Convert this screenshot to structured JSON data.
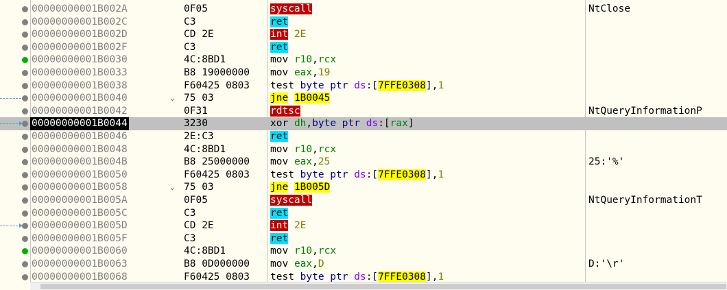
{
  "rows": [
    {
      "addr": "00000000001B002A",
      "bytes": "0F05",
      "mn": "syscall",
      "mn_style": "red",
      "ops": [],
      "comment": "NtClose",
      "bp": "gray"
    },
    {
      "addr": "00000000001B002C",
      "bytes": "C3",
      "mn": "ret",
      "mn_style": "cyan",
      "ops": [],
      "comment": "",
      "bp": "gray"
    },
    {
      "addr": "00000000001B002D",
      "bytes": "CD 2E",
      "mn": "int",
      "mn_style": "red",
      "ops": [
        {
          "t": " "
        },
        {
          "t": "2E",
          "c": "num"
        }
      ],
      "comment": "",
      "bp": "gray"
    },
    {
      "addr": "00000000001B002F",
      "bytes": "C3",
      "mn": "ret",
      "mn_style": "cyan",
      "ops": [],
      "comment": "",
      "bp": "gray"
    },
    {
      "addr": "00000000001B0030",
      "bytes": "4C:8BD1",
      "mn": "mov",
      "mn_style": "plain",
      "ops": [
        {
          "t": " "
        },
        {
          "t": "r10",
          "c": "reg"
        },
        {
          "t": ","
        },
        {
          "t": "rcx",
          "c": "reg"
        }
      ],
      "comment": "",
      "bp": "green"
    },
    {
      "addr": "00000000001B0033",
      "bytes": "B8 19000000",
      "mn": "mov",
      "mn_style": "plain",
      "ops": [
        {
          "t": " "
        },
        {
          "t": "eax",
          "c": "reg"
        },
        {
          "t": ","
        },
        {
          "t": "19",
          "c": "num"
        }
      ],
      "comment": "",
      "bp": "gray"
    },
    {
      "addr": "00000000001B0038",
      "bytes": "F60425 0803",
      "mn": "test",
      "mn_style": "plain",
      "ops": [
        {
          "t": " "
        },
        {
          "t": "byte ptr",
          "c": "kw"
        },
        {
          "t": " "
        },
        {
          "t": "ds",
          "c": "seg"
        },
        {
          "t": ":["
        },
        {
          "t": "7FFE0308",
          "c": "hl"
        },
        {
          "t": "],"
        },
        {
          "t": "1",
          "c": "num"
        }
      ],
      "comment": "",
      "bp": "gray"
    },
    {
      "addr": "00000000001B0040",
      "bytes": "75 03",
      "mn": "jne",
      "mn_style": "yellow",
      "ops": [
        {
          "t": " "
        },
        {
          "t": "1B0045",
          "c": "hl"
        }
      ],
      "comment": "",
      "bp": "gray",
      "mark": "⌄",
      "arrow": "in"
    },
    {
      "addr": "00000000001B0042",
      "bytes": "0F31",
      "mn": "rdtsc",
      "mn_style": "red",
      "ops": [],
      "comment": "NtQueryInformationP",
      "bp": "gray"
    },
    {
      "addr": "00000000001B0044",
      "bytes": "3230",
      "mn": "xor",
      "mn_style": "plain",
      "ops": [
        {
          "t": " "
        },
        {
          "t": "dh",
          "c": "reg"
        },
        {
          "t": ","
        },
        {
          "t": "byte ptr",
          "c": "kw"
        },
        {
          "t": " "
        },
        {
          "t": "ds",
          "c": "seg"
        },
        {
          "t": ":["
        },
        {
          "t": "rax",
          "c": "reg"
        },
        {
          "t": "]"
        }
      ],
      "comment": "",
      "bp": "gray",
      "selected": true,
      "arrow": "head"
    },
    {
      "addr": "00000000001B0046",
      "bytes": "2E:C3",
      "mn": "ret",
      "mn_style": "cyan",
      "ops": [],
      "comment": "",
      "bp": "gray"
    },
    {
      "addr": "00000000001B0048",
      "bytes": "4C:8BD1",
      "mn": "mov",
      "mn_style": "plain",
      "ops": [
        {
          "t": " "
        },
        {
          "t": "r10",
          "c": "reg"
        },
        {
          "t": ","
        },
        {
          "t": "rcx",
          "c": "reg"
        }
      ],
      "comment": "",
      "bp": "gray"
    },
    {
      "addr": "00000000001B004B",
      "bytes": "B8 25000000",
      "mn": "mov",
      "mn_style": "plain",
      "ops": [
        {
          "t": " "
        },
        {
          "t": "eax",
          "c": "reg"
        },
        {
          "t": ","
        },
        {
          "t": "25",
          "c": "num"
        }
      ],
      "comment": "25:'%'",
      "bp": "gray"
    },
    {
      "addr": "00000000001B0050",
      "bytes": "F60425 0803",
      "mn": "test",
      "mn_style": "plain",
      "ops": [
        {
          "t": " "
        },
        {
          "t": "byte ptr",
          "c": "kw"
        },
        {
          "t": " "
        },
        {
          "t": "ds",
          "c": "seg"
        },
        {
          "t": ":["
        },
        {
          "t": "7FFE0308",
          "c": "hl"
        },
        {
          "t": "],"
        },
        {
          "t": "1",
          "c": "num"
        }
      ],
      "comment": "",
      "bp": "gray"
    },
    {
      "addr": "00000000001B0058",
      "bytes": "75 03",
      "mn": "jne",
      "mn_style": "yellow",
      "ops": [
        {
          "t": " "
        },
        {
          "t": "1B005D",
          "c": "hl"
        }
      ],
      "comment": "",
      "bp": "gray",
      "mark": "⌄"
    },
    {
      "addr": "00000000001B005A",
      "bytes": "0F05",
      "mn": "syscall",
      "mn_style": "red",
      "ops": [],
      "comment": "NtQueryInformationT",
      "bp": "gray"
    },
    {
      "addr": "00000000001B005C",
      "bytes": "C3",
      "mn": "ret",
      "mn_style": "cyan",
      "ops": [],
      "comment": "",
      "bp": "gray"
    },
    {
      "addr": "00000000001B005D",
      "bytes": "CD 2E",
      "mn": "int",
      "mn_style": "red",
      "ops": [
        {
          "t": " "
        },
        {
          "t": "2E",
          "c": "num"
        }
      ],
      "comment": "",
      "bp": "gray",
      "arrow": "head"
    },
    {
      "addr": "00000000001B005F",
      "bytes": "C3",
      "mn": "ret",
      "mn_style": "cyan",
      "ops": [],
      "comment": "",
      "bp": "gray"
    },
    {
      "addr": "00000000001B0060",
      "bytes": "4C:8BD1",
      "mn": "mov",
      "mn_style": "plain",
      "ops": [
        {
          "t": " "
        },
        {
          "t": "r10",
          "c": "reg"
        },
        {
          "t": ","
        },
        {
          "t": "rcx",
          "c": "reg"
        }
      ],
      "comment": "",
      "bp": "green"
    },
    {
      "addr": "00000000001B0063",
      "bytes": "B8 0D000000",
      "mn": "mov",
      "mn_style": "plain",
      "ops": [
        {
          "t": " "
        },
        {
          "t": "eax",
          "c": "reg"
        },
        {
          "t": ","
        },
        {
          "t": "D",
          "c": "num"
        }
      ],
      "comment": "D:'\\r'",
      "bp": "gray"
    },
    {
      "addr": "00000000001B0068",
      "bytes": "F60425 0803",
      "mn": "test",
      "mn_style": "plain",
      "ops": [
        {
          "t": " "
        },
        {
          "t": "byte ptr",
          "c": "kw"
        },
        {
          "t": " "
        },
        {
          "t": "ds",
          "c": "seg"
        },
        {
          "t": ":["
        },
        {
          "t": "7FFE0308",
          "c": "hl"
        },
        {
          "t": "],"
        },
        {
          "t": "1",
          "c": "num"
        }
      ],
      "comment": "",
      "bp": "gray"
    }
  ],
  "colors": {
    "background": "#fffcf0",
    "selection": "#c0c0c0",
    "red_mnemonic": "#c00000",
    "cyan_mnemonic": "#00e0ff",
    "yellow_mnemonic": "#ffff00",
    "register": "#008000",
    "segment": "#8000ff",
    "keyword": "#000080",
    "number": "#808000"
  },
  "icons": {
    "breakpoint": "breakpoint-dot-icon",
    "jump_arrow": "jump-arrow-icon",
    "branch_marker": "branch-down-icon"
  }
}
